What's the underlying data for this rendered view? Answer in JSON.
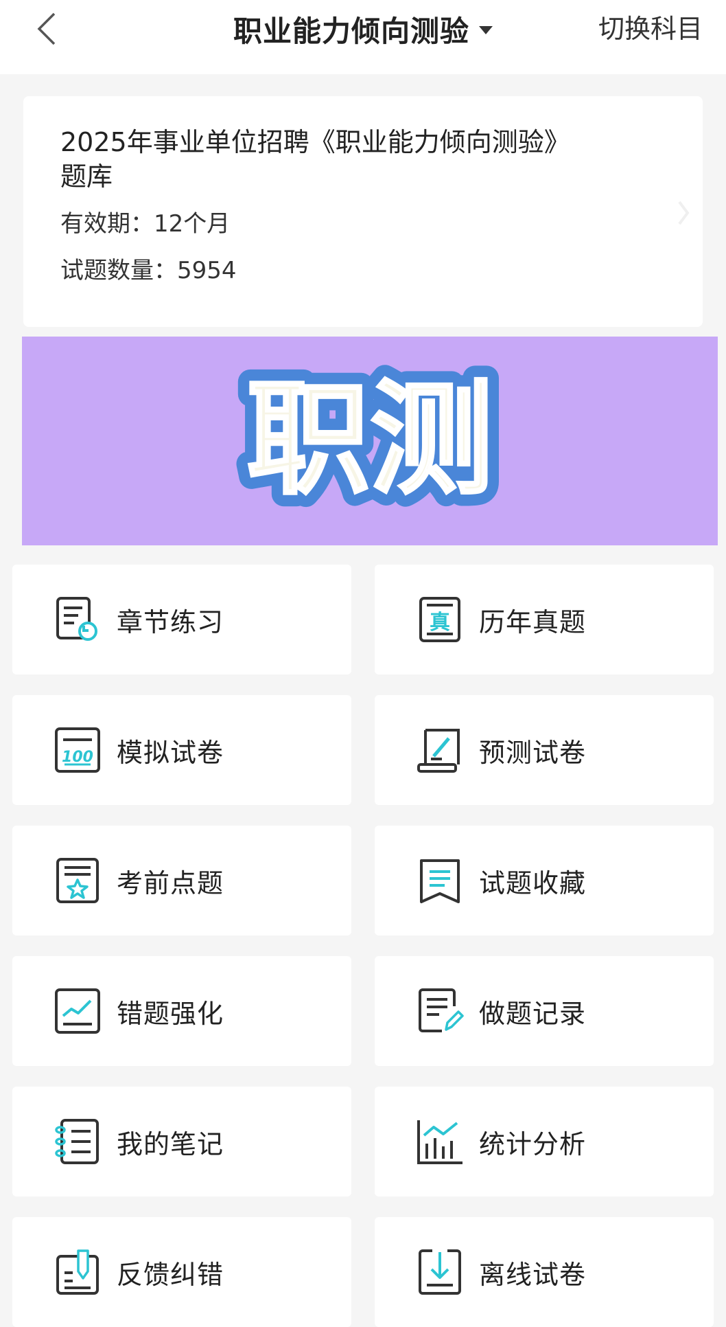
{
  "header": {
    "title": "职业能力倾向测验",
    "switch_label": "切换科目"
  },
  "info": {
    "title_line1": "2025年事业单位招聘《职业能力倾向测验》",
    "title_line2": "题库",
    "validity_label": "有效期：",
    "validity_value": "12个月",
    "count_label": "试题数量：",
    "count_value": "5954"
  },
  "banner": {
    "text": "职测",
    "background": "#c7a8f7",
    "text_color": "#f7f5e6",
    "outline_color": "#4a86d8"
  },
  "menu": [
    {
      "label": "章节练习",
      "icon": "chapter-practice-icon"
    },
    {
      "label": "历年真题",
      "icon": "past-exams-icon"
    },
    {
      "label": "模拟试卷",
      "icon": "mock-paper-icon"
    },
    {
      "label": "预测试卷",
      "icon": "predict-paper-icon"
    },
    {
      "label": "考前点题",
      "icon": "pre-exam-tips-icon"
    },
    {
      "label": "试题收藏",
      "icon": "favorites-icon"
    },
    {
      "label": "错题强化",
      "icon": "wrong-questions-icon"
    },
    {
      "label": "做题记录",
      "icon": "practice-record-icon"
    },
    {
      "label": "我的笔记",
      "icon": "notes-icon"
    },
    {
      "label": "统计分析",
      "icon": "statistics-icon"
    },
    {
      "label": "反馈纠错",
      "icon": "feedback-icon"
    },
    {
      "label": "离线试卷",
      "icon": "offline-paper-icon"
    }
  ],
  "colors": {
    "accent": "#2cc4d2",
    "icon_stroke": "#333333"
  }
}
